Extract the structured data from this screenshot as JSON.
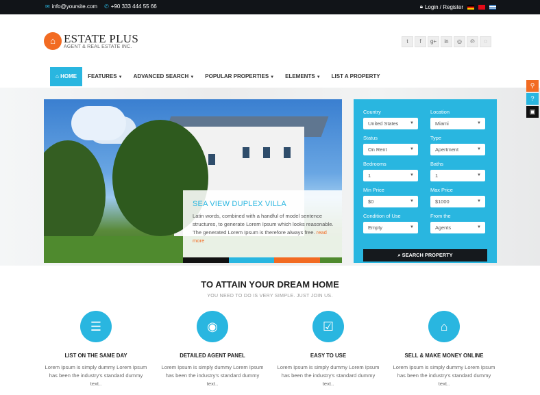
{
  "topbar": {
    "email": "info@yoursite.com",
    "phone": "+90 333 444 55 66",
    "login": "Login / Register",
    "email_icon": "envelope-icon",
    "phone_icon": "phone-icon",
    "lock_icon": "lock-icon"
  },
  "header": {
    "logo_title": "ESTATE PLUS",
    "logo_subtitle": "AGENT & REAL ESTATE INC.",
    "social": [
      "twitter-icon",
      "facebook-icon",
      "google-plus-icon",
      "linkedin-icon",
      "github-icon",
      "pinterest-icon",
      "rss-icon"
    ]
  },
  "nav": {
    "items": [
      {
        "label": "HOME",
        "icon": "home-icon",
        "active": true
      },
      {
        "label": "FEATURES",
        "dropdown": true
      },
      {
        "label": "ADVANCED SEARCH",
        "dropdown": true
      },
      {
        "label": "POPULAR PROPERTIES",
        "dropdown": true
      },
      {
        "label": "ELEMENTS",
        "dropdown": true
      },
      {
        "label": "LIST A PROPERTY",
        "dropdown": false
      }
    ]
  },
  "hero": {
    "title": "SEA VIEW DUPLEX VILLA",
    "text": "Latin words, combined with a handful of model sentence structures, to generate Lorem Ipsum which looks reasonable. The generated Lorem Ipsum is therefore always free.",
    "more": "read more"
  },
  "search": {
    "fields": [
      {
        "label": "Country",
        "value": "United States"
      },
      {
        "label": "Location",
        "value": "Miami"
      },
      {
        "label": "Status",
        "value": "On Rent"
      },
      {
        "label": "Type",
        "value": "Apertment"
      },
      {
        "label": "Bedrooms",
        "value": "1"
      },
      {
        "label": "Baths",
        "value": "1"
      },
      {
        "label": "Min Price",
        "value": "$0"
      },
      {
        "label": "Max Price",
        "value": "$1000"
      },
      {
        "label": "Condition of Use",
        "value": "Empty"
      },
      {
        "label": "From the",
        "value": "Agents"
      }
    ],
    "submit": "SEARCH PROPERTY"
  },
  "sidetabs": [
    {
      "icon": "link-icon",
      "color": "#f26b22"
    },
    {
      "icon": "help-icon",
      "color": "#29b6e0"
    },
    {
      "icon": "lock-icon",
      "color": "#111111"
    }
  ],
  "section": {
    "title": "TO ATTAIN YOUR DREAM HOME",
    "subtitle": "YOU NEED TO DO IS VERY SIMPLE. JUST JOIN US.",
    "features": [
      {
        "title": "LIST ON THE SAME DAY",
        "text": "Lorem Ipsum is simply dummy Lorem Ipsum has been the industry's standard dummy text..",
        "icon": "list-icon"
      },
      {
        "title": "DETAILED AGENT PANEL",
        "text": "Lorem Ipsum is simply dummy Lorem Ipsum has been the industry's standard dummy text..",
        "icon": "eye-icon"
      },
      {
        "title": "EASY TO USE",
        "text": "Lorem Ipsum is simply dummy Lorem Ipsum has been the industry's standard dummy text..",
        "icon": "check-icon"
      },
      {
        "title": "SELL & MAKE MONEY ONLINE",
        "text": "Lorem Ipsum is simply dummy Lorem Ipsum has been the industry's standard dummy text..",
        "icon": "home-icon"
      }
    ]
  },
  "colors": {
    "accent": "#29b6e0",
    "orange": "#f26b22",
    "dark": "#111418"
  }
}
